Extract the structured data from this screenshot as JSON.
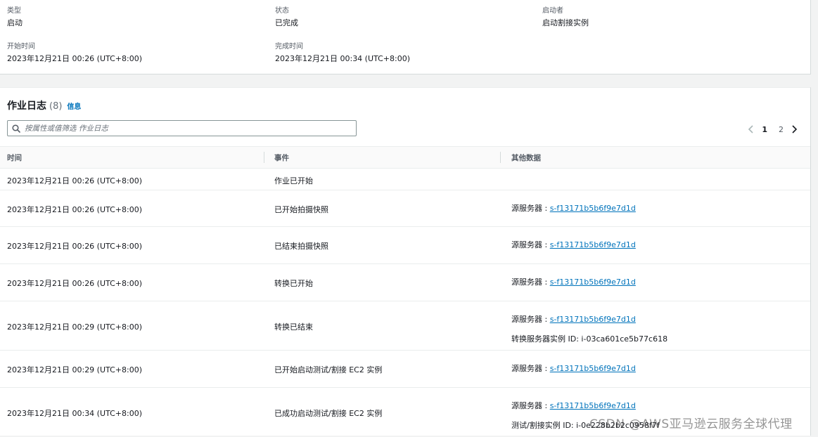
{
  "summary": {
    "type_label": "类型",
    "type_value": "启动",
    "status_label": "状态",
    "status_value": "已完成",
    "initiator_label": "启动者",
    "initiator_value": "启动割接实例",
    "start_label": "开始时间",
    "start_value": "2023年12月21日 00:26 (UTC+8:00)",
    "end_label": "完成时间",
    "end_value": "2023年12月21日 00:34 (UTC+8:00)"
  },
  "job_log": {
    "title": "作业日志",
    "count": "(8)",
    "info_link": "信息",
    "search_placeholder": "按属性或值筛选 作业日志",
    "pagination": {
      "pages": [
        "1",
        "2"
      ],
      "current_page": "1"
    },
    "columns": {
      "time": "时间",
      "event": "事件",
      "data": "其他数据"
    },
    "rows": [
      {
        "time": "2023年12月21日 00:26 (UTC+8:00)",
        "event": "作业已开始",
        "data": []
      },
      {
        "time": "2023年12月21日 00:26 (UTC+8:00)",
        "event": "已开始拍摄快照",
        "data": [
          {
            "label": "源服务器 : ",
            "value": "s-f13171b5b6f9e7d1d",
            "link": true
          }
        ]
      },
      {
        "time": "2023年12月21日 00:26 (UTC+8:00)",
        "event": "已结束拍摄快照",
        "data": [
          {
            "label": "源服务器 : ",
            "value": "s-f13171b5b6f9e7d1d",
            "link": true
          }
        ]
      },
      {
        "time": "2023年12月21日 00:26 (UTC+8:00)",
        "event": "转换已开始",
        "data": [
          {
            "label": "源服务器 : ",
            "value": "s-f13171b5b6f9e7d1d",
            "link": true
          }
        ]
      },
      {
        "time": "2023年12月21日 00:29 (UTC+8:00)",
        "event": "转换已结束",
        "data": [
          {
            "label": "源服务器 : ",
            "value": "s-f13171b5b6f9e7d1d",
            "link": true
          },
          {
            "label": "转换服务器实例 ID: ",
            "value": "i-03ca601ce5b77c618",
            "link": false
          }
        ]
      },
      {
        "time": "2023年12月21日 00:29 (UTC+8:00)",
        "event": "已开始启动测试/割接 EC2 实例",
        "data": [
          {
            "label": "源服务器 : ",
            "value": "s-f13171b5b6f9e7d1d",
            "link": true
          }
        ]
      },
      {
        "time": "2023年12月21日 00:34 (UTC+8:00)",
        "event": "已成功启动测试/割接 EC2 实例",
        "data": [
          {
            "label": "源服务器 : ",
            "value": "s-f13171b5b6f9e7d1d",
            "link": true
          },
          {
            "label": "测试/割接实例 ID: ",
            "value": "i-0e228b2b2c0958f7f",
            "link": false
          }
        ]
      }
    ]
  },
  "watermark": "CSDN @AWS亚马逊云服务全球代理",
  "colors": {
    "link": "#0073bb",
    "border": "#eaeded",
    "page_bg": "#f2f3f3"
  }
}
